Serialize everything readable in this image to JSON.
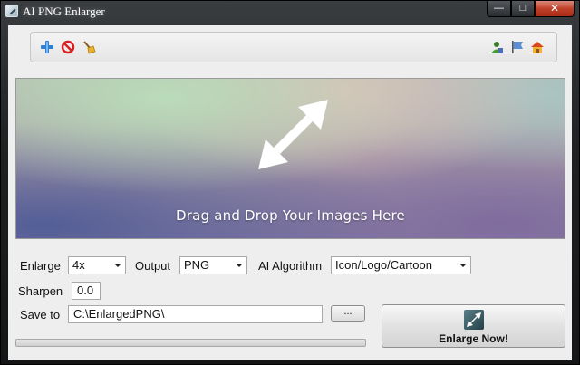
{
  "window": {
    "title": "AI PNG Enlarger",
    "minimize": "—",
    "maximize": "□",
    "close": "✕"
  },
  "toolbar": {
    "left_icons": [
      "add-icon",
      "remove-icon",
      "clear-broom-icon"
    ],
    "right_icons": [
      "user-icon",
      "flag-icon",
      "home-icon"
    ]
  },
  "drop_zone": {
    "text": "Drag and Drop Your Images Here",
    "icon": "resize-diagonal-arrow-icon"
  },
  "settings": {
    "enlarge_label": "Enlarge",
    "enlarge_value": "4x",
    "output_label": "Output",
    "output_value": "PNG",
    "algorithm_label": "AI Algorithm",
    "algorithm_value": "Icon/Logo/Cartoon",
    "sharpen_label": "Sharpen",
    "sharpen_value": "0.0",
    "save_label": "Save to",
    "save_value": "C:\\EnlargedPNG\\",
    "browse_label": "..."
  },
  "progress": {
    "value": 0
  },
  "actions": {
    "enlarge_label": "Enlarge Now!"
  },
  "colors": {
    "accent_green": "#3fae2a",
    "close_red": "#c1412a",
    "add_blue": "#2f7fd0",
    "remove_red": "#d81e1e"
  }
}
